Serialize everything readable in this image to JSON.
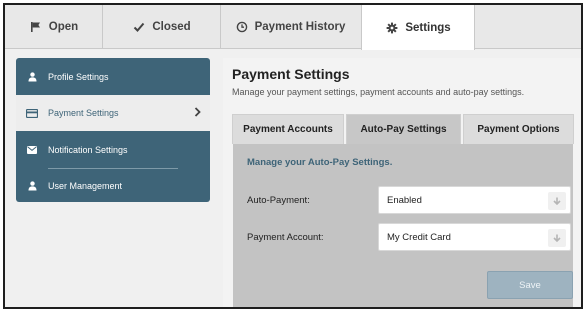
{
  "top_tabs": [
    {
      "label": "Open",
      "icon": "flag-icon"
    },
    {
      "label": "Closed",
      "icon": "checkmark-icon"
    },
    {
      "label": "Payment History",
      "icon": "clock-icon"
    },
    {
      "label": "Settings",
      "icon": "gear-icon",
      "active": true
    }
  ],
  "sidebar": {
    "items": [
      {
        "label": "Profile Settings",
        "icon": "user-icon"
      },
      {
        "label": "Payment Settings",
        "icon": "credit-card-icon",
        "active": true
      },
      {
        "label": "Notification Settings",
        "icon": "envelope-icon"
      },
      {
        "label": "User Management",
        "icon": "user-icon"
      }
    ]
  },
  "main": {
    "title": "Payment Settings",
    "subtitle": "Manage your payment settings, payment accounts and auto-pay settings.",
    "tabs": [
      {
        "label": "Payment Accounts"
      },
      {
        "label": "Auto-Pay Settings",
        "active": true
      },
      {
        "label": "Payment Options"
      }
    ],
    "panel": {
      "heading": "Manage your Auto-Pay Settings.",
      "auto_payment": {
        "label": "Auto-Payment:",
        "value": "Enabled"
      },
      "payment_account": {
        "label": "Payment Account:",
        "value": "My Credit Card"
      },
      "save_label": "Save"
    }
  },
  "colors": {
    "sidebar_bg": "#3e6478",
    "accent_heading": "#3e6478",
    "panel_bg": "#c3c3c3",
    "save_button": "#9eb3c0"
  }
}
